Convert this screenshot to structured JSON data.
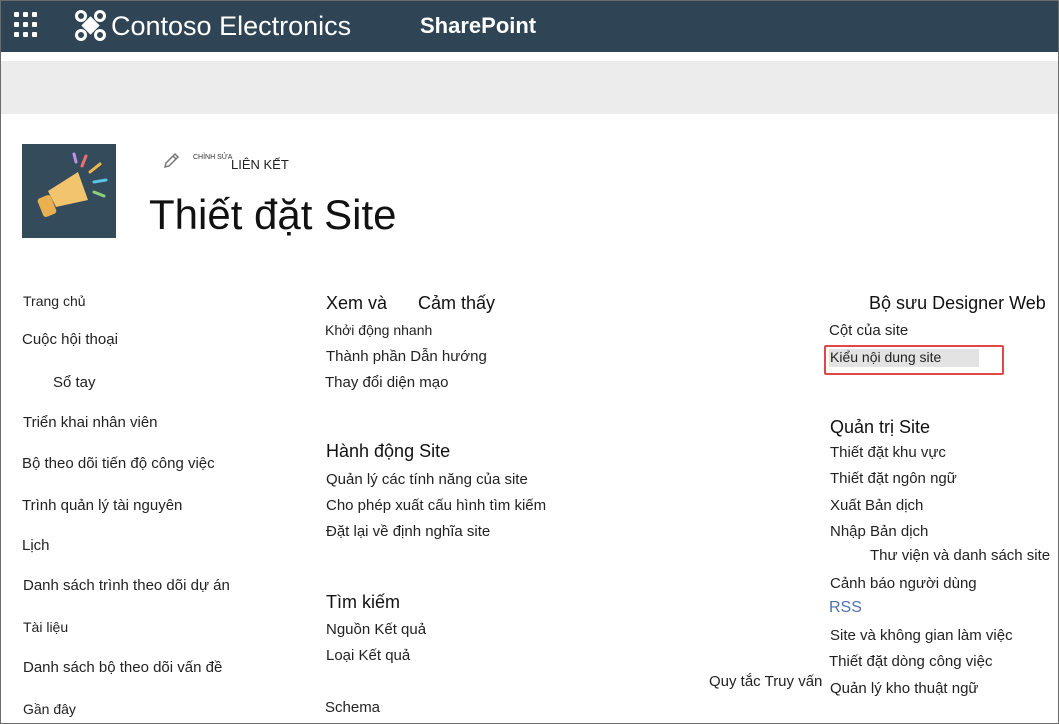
{
  "suite_bar": {
    "brand": "Contoso Electronics",
    "app": "SharePoint",
    "colors": {
      "background": "#2f4454",
      "text": "#ffffff"
    }
  },
  "header": {
    "edit_small": "CHỈNH SỬA",
    "edit_links": "LIÊN KẾT",
    "title": "Thiết đặt Site"
  },
  "left_nav": [
    "Trang chủ",
    "Cuộc hội thoại",
    "Sổ tay",
    "Triển khai nhân viên",
    "Bộ theo dõi tiến độ công việc",
    "Trình quản lý tài nguyên",
    "Lịch",
    "Danh sách trình theo dõi dự án",
    "Tài liệu",
    "Danh sách bộ theo dõi vấn đề",
    "Gần đây"
  ],
  "sections": {
    "look_feel": {
      "heading_a": "Xem và",
      "heading_b": "Cảm thấy",
      "links": [
        "Khởi động nhanh",
        "Thành phần Dẫn hướng",
        "Thay đổi diện mạo"
      ]
    },
    "site_actions": {
      "heading": "Hành động Site",
      "links": [
        "Quản lý các tính năng của site",
        "Cho phép xuất cấu hình tìm kiếm",
        "Đặt lại về định nghĩa site"
      ]
    },
    "search": {
      "heading": "Tìm kiếm",
      "links": [
        "Nguồn Kết quả",
        "Loại Kết quả",
        "Quy tắc Truy vấn",
        "Schema"
      ]
    },
    "web_designer": {
      "heading": "Bộ sưu Designer Web",
      "links": [
        "Cột của site",
        "Kiểu nội dung site"
      ]
    },
    "site_admin": {
      "heading": "Quản trị Site",
      "links": [
        "Thiết đặt khu vực",
        "Thiết đặt ngôn ngữ",
        "Xuất Bản dịch",
        "Nhập Bản dịch",
        "Thư viện và danh sách site",
        "Cảnh báo người dùng",
        "RSS",
        "Site và không gian làm việc",
        "Thiết đặt dòng công việc",
        "Quản lý kho thuật ngữ"
      ]
    }
  },
  "accent": {
    "highlight_border": "#e0474c",
    "rss_link": "#4f6fb3"
  }
}
